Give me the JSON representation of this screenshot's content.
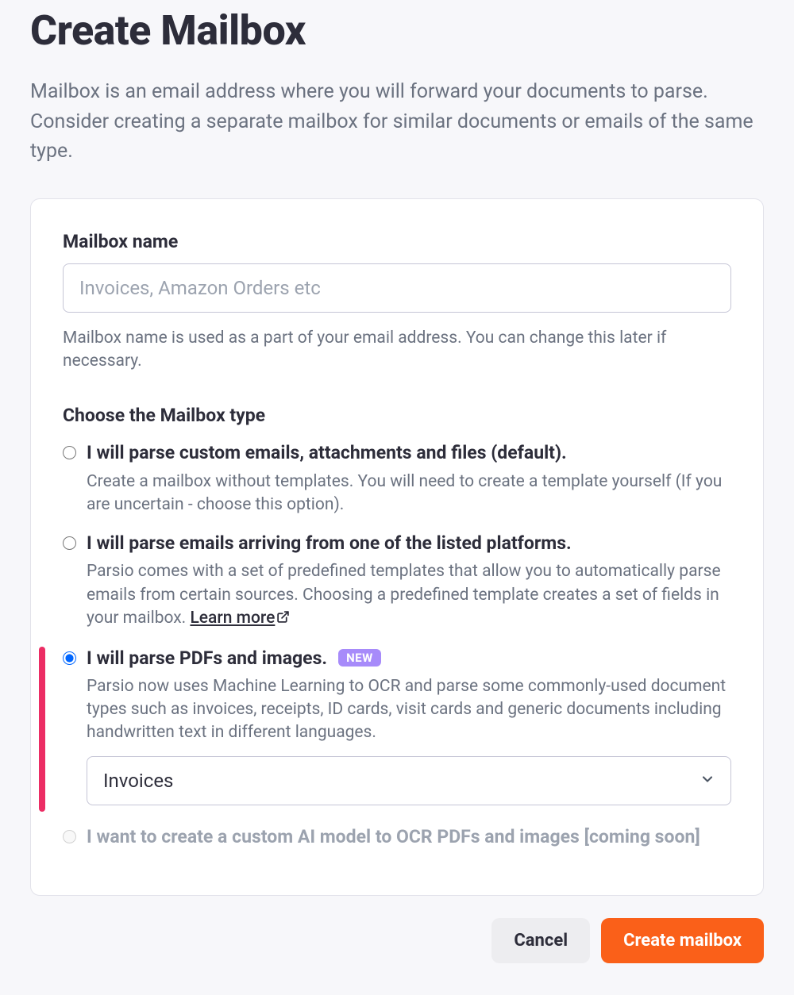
{
  "header": {
    "title": "Create Mailbox",
    "description": "Mailbox is an email address where you will forward your documents to parse. Consider creating a separate mailbox for similar documents or emails of the same type."
  },
  "form": {
    "name_label": "Mailbox name",
    "name_placeholder": "Invoices, Amazon Orders etc",
    "name_value": "",
    "name_helper": "Mailbox name is used as a part of your email address. You can change this later if necessary.",
    "type_label": "Choose the Mailbox type",
    "options": [
      {
        "title": "I will parse custom emails, attachments and files (default).",
        "desc": "Create a mailbox without templates. You will need to create a template yourself (If you are uncertain - choose this option)."
      },
      {
        "title": "I will parse emails arriving from one of the listed platforms.",
        "desc_prefix": "Parsio comes with a set of predefined templates that allow you to automatically parse emails from certain sources. Choosing a predefined template creates a set of fields in your mailbox. ",
        "learn_more": "Learn more"
      },
      {
        "title": "I will parse PDFs and images.",
        "badge": "NEW",
        "desc": "Parsio now uses Machine Learning to OCR and parse some commonly-used document types such as invoices, receipts, ID cards, visit cards and generic documents including handwritten text in different languages.",
        "select_value": "Invoices"
      },
      {
        "title": "I want to create a custom AI model to OCR PDFs and images [coming soon]"
      }
    ],
    "selected_index": 2
  },
  "footer": {
    "cancel": "Cancel",
    "submit": "Create mailbox"
  }
}
